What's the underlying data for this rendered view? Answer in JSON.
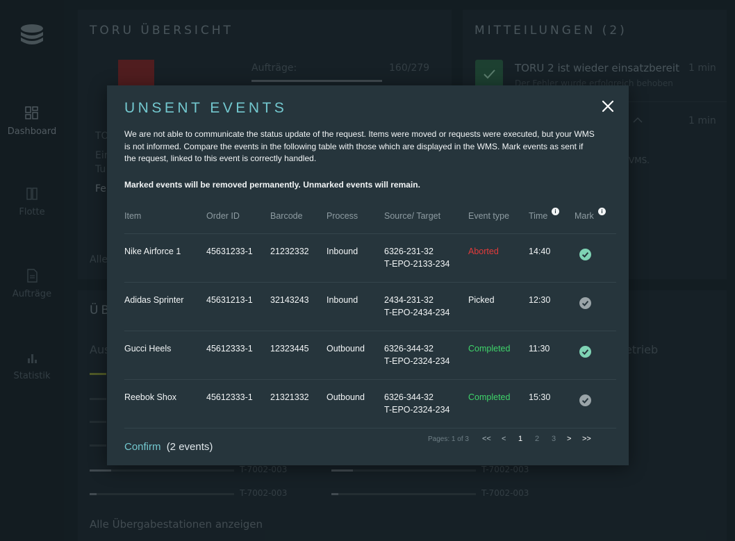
{
  "sidebar": {
    "items": [
      {
        "label": "Dashboard",
        "icon": "dashboard-icon"
      },
      {
        "label": "Flotte",
        "icon": "fleet-icon"
      },
      {
        "label": "Aufträge",
        "icon": "orders-icon"
      },
      {
        "label": "Statistik",
        "icon": "statistics-icon"
      }
    ]
  },
  "background": {
    "overview_title": "TORU ÜBERSICHT",
    "orders_label": "Aufträge:",
    "orders_value": "160/279",
    "toru_label_fragment": "TO",
    "toru_sub_1": "Ein",
    "toru_sub_2": "Tu",
    "toru_sub_3": "Fe",
    "all_fragment": "Alle",
    "section_fragment": "ÜB",
    "aus_fragment": "Aus",
    "betrieb_fragment": "etrieb",
    "station_1": "T-7002-003",
    "station_2": "T-7002-003",
    "station_3": "T-7002-003",
    "station_4": "T-7002-003",
    "show_all_stations": "Alle Übergabestationen anzeigen",
    "notifications_title": "MITTEILUNGEN (2)",
    "notif_1_title": "TORU 2 ist wieder einsatzbereit",
    "notif_1_sub": "Der Fehler wurde erfolgreich behoben",
    "notif_1_time": "1 min",
    "notif_2_time": "1 min",
    "notif_2_fragment": "VMS."
  },
  "modal": {
    "title": "UNSENT EVENTS",
    "description": "We are not able to communicate the status update of the request. Items were moved or requests were executed, but your WMS is not informed. Compare the events in the following table with those which are displayed in the WMS. Mark events as sent if the request, linked to this event is correctly handled.",
    "warning": "Marked events will be removed permanently. Unmarked events will remain.",
    "columns": {
      "item": "Item",
      "order_id": "Order ID",
      "barcode": "Barcode",
      "process": "Process",
      "source_target": "Source/ Target",
      "event_type": "Event type",
      "time": "Time",
      "mark": "Mark"
    },
    "rows": [
      {
        "item": "Nike Airforce 1",
        "order_id": "45631233-1",
        "barcode": "21232332",
        "process": "Inbound",
        "source": "6326-231-32",
        "target": "T-EPO-2133-234",
        "event_type": "Aborted",
        "event_color": "#e23b3b",
        "time": "14:40",
        "marked": true
      },
      {
        "item": "Adidas Sprinter",
        "order_id": "45631213-1",
        "barcode": "32143243",
        "process": "Inbound",
        "source": "2434-231-32",
        "target": "T-EPO-2434-234",
        "event_type": "Picked",
        "event_color": "#f2f5f6",
        "time": "12:30",
        "marked": false
      },
      {
        "item": "Gucci Heels",
        "order_id": "45612333-1",
        "barcode": "12323445",
        "process": "Outbound",
        "source": "6326-344-32",
        "target": "T-EPO-2324-234",
        "event_type": "Completed",
        "event_color": "#3fd46a",
        "time": "11:30",
        "marked": true
      },
      {
        "item": "Reebok Shox",
        "order_id": "45612333-1",
        "barcode": "21321332",
        "process": "Outbound",
        "source": "6326-344-32",
        "target": "T-EPO-2324-234",
        "event_type": "Completed",
        "event_color": "#3fd46a",
        "time": "15:30",
        "marked": false
      }
    ],
    "confirm_label": "Confirm",
    "confirm_count": "(2 events)",
    "pagination": {
      "info": "Pages: 1 of 3",
      "first": "<<",
      "prev": "<",
      "pages": [
        "1",
        "2",
        "3"
      ],
      "next": ">",
      "last": ">>"
    }
  },
  "colors": {
    "accent": "#73c8cf",
    "marked": "#7fd3b4",
    "unmarked": "#9aa4a8"
  }
}
